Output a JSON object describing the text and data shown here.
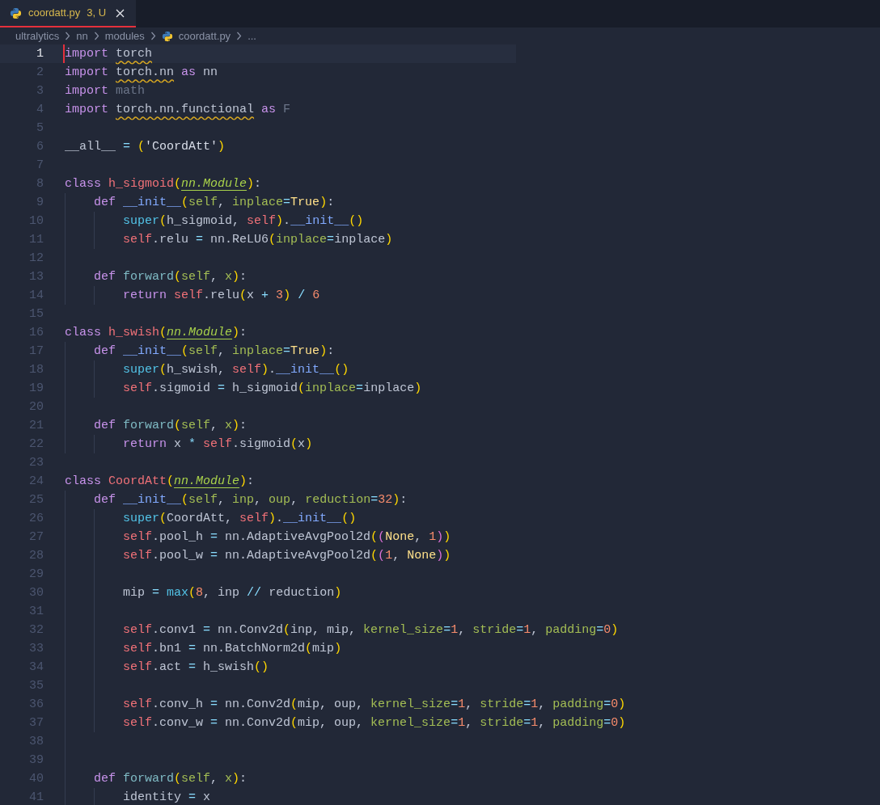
{
  "tab": {
    "filename": "coordatt.py",
    "badge": "3, U",
    "selected": true
  },
  "breadcrumb": [
    {
      "kind": "folder",
      "text": "ultralytics"
    },
    {
      "kind": "folder",
      "text": "nn"
    },
    {
      "kind": "folder",
      "text": "modules"
    },
    {
      "kind": "file",
      "text": "coordatt.py"
    },
    {
      "kind": "more",
      "text": "..."
    }
  ],
  "lines": [
    {
      "number": "1",
      "current": true,
      "tokens": [
        {
          "kind": "kw",
          "text": "import "
        },
        {
          "kind": "warn",
          "text": "torch"
        }
      ]
    },
    {
      "number": "2",
      "current": false,
      "tokens": [
        {
          "kind": "kw",
          "text": "import "
        },
        {
          "kind": "warn",
          "text": "torch.nn"
        },
        {
          "kind": "kw",
          "text": " as"
        },
        {
          "kind": "pl",
          "text": " nn"
        }
      ]
    },
    {
      "number": "3",
      "current": false,
      "tokens": [
        {
          "kind": "kw",
          "text": "import "
        },
        {
          "kind": "dim",
          "text": "math"
        }
      ]
    },
    {
      "number": "4",
      "current": false,
      "tokens": [
        {
          "kind": "kw",
          "text": "import "
        },
        {
          "kind": "warn",
          "text": "torch.nn.functional"
        },
        {
          "kind": "kw",
          "text": " as "
        },
        {
          "kind": "dim",
          "text": "F"
        }
      ]
    },
    {
      "number": "5",
      "current": false
    },
    {
      "number": "6",
      "current": false,
      "tokens": [
        {
          "kind": "pl",
          "text": "__all__ "
        },
        {
          "kind": "op",
          "text": "= "
        },
        {
          "kind": "p1",
          "text": "("
        },
        {
          "kind": "str",
          "text": "'CoordAtt'"
        },
        {
          "kind": "p1",
          "text": ")"
        }
      ]
    },
    {
      "number": "7",
      "current": false
    },
    {
      "number": "8",
      "current": false,
      "tokens": [
        {
          "kind": "kw",
          "text": "class "
        },
        {
          "kind": "cls",
          "text": "h_sigmoid"
        },
        {
          "kind": "p1",
          "text": "("
        },
        {
          "kind": "base",
          "text": "nn.Module"
        },
        {
          "kind": "p1",
          "text": ")"
        },
        {
          "kind": "pl",
          "text": ":"
        }
      ]
    },
    {
      "number": "9",
      "current": false,
      "tokens": [
        {
          "kind": "kw",
          "text": "    def "
        },
        {
          "kind": "fn",
          "text": "__init__"
        },
        {
          "kind": "p1",
          "text": "("
        },
        {
          "kind": "prm",
          "text": "self"
        },
        {
          "kind": "pl",
          "text": ", "
        },
        {
          "kind": "prm",
          "text": "inplace"
        },
        {
          "kind": "op",
          "text": "="
        },
        {
          "kind": "con",
          "text": "True"
        },
        {
          "kind": "p1",
          "text": ")"
        },
        {
          "kind": "pl",
          "text": ":"
        }
      ]
    },
    {
      "number": "10",
      "current": false,
      "tokens": [
        {
          "kind": "bi",
          "text": "        super"
        },
        {
          "kind": "p1",
          "text": "("
        },
        {
          "kind": "pl",
          "text": "h_sigmoid, "
        },
        {
          "kind": "slf",
          "text": "self"
        },
        {
          "kind": "p1",
          "text": ")"
        },
        {
          "kind": "pl",
          "text": "."
        },
        {
          "kind": "fn",
          "text": "__init__"
        },
        {
          "kind": "p1",
          "text": "()"
        }
      ]
    },
    {
      "number": "11",
      "current": false,
      "tokens": [
        {
          "kind": "slf",
          "text": "        self"
        },
        {
          "kind": "pl",
          "text": ".relu "
        },
        {
          "kind": "op",
          "text": "="
        },
        {
          "kind": "pl",
          "text": " nn.ReLU6"
        },
        {
          "kind": "p1",
          "text": "("
        },
        {
          "kind": "prm",
          "text": "inplace"
        },
        {
          "kind": "op",
          "text": "="
        },
        {
          "kind": "pl",
          "text": "inplace"
        },
        {
          "kind": "p1",
          "text": ")"
        }
      ]
    },
    {
      "number": "12",
      "current": false
    },
    {
      "number": "13",
      "current": false,
      "tokens": [
        {
          "kind": "kw",
          "text": "    def "
        },
        {
          "kind": "mth",
          "text": "forward"
        },
        {
          "kind": "p1",
          "text": "("
        },
        {
          "kind": "prm",
          "text": "self"
        },
        {
          "kind": "pl",
          "text": ", "
        },
        {
          "kind": "prm",
          "text": "x"
        },
        {
          "kind": "p1",
          "text": ")"
        },
        {
          "kind": "pl",
          "text": ":"
        }
      ]
    },
    {
      "number": "14",
      "current": false,
      "tokens": [
        {
          "kind": "kw",
          "text": "        return "
        },
        {
          "kind": "slf",
          "text": "self"
        },
        {
          "kind": "pl",
          "text": ".relu"
        },
        {
          "kind": "p1",
          "text": "("
        },
        {
          "kind": "pl",
          "text": "x "
        },
        {
          "kind": "op",
          "text": "+ "
        },
        {
          "kind": "num",
          "text": "3"
        },
        {
          "kind": "p1",
          "text": ") "
        },
        {
          "kind": "op",
          "text": "/ "
        },
        {
          "kind": "num",
          "text": "6"
        }
      ]
    },
    {
      "number": "15",
      "current": false
    },
    {
      "number": "16",
      "current": false,
      "tokens": [
        {
          "kind": "kw",
          "text": "class "
        },
        {
          "kind": "cls",
          "text": "h_swish"
        },
        {
          "kind": "p1",
          "text": "("
        },
        {
          "kind": "base",
          "text": "nn.Module"
        },
        {
          "kind": "p1",
          "text": ")"
        },
        {
          "kind": "pl",
          "text": ":"
        }
      ]
    },
    {
      "number": "17",
      "current": false,
      "tokens": [
        {
          "kind": "kw",
          "text": "    def "
        },
        {
          "kind": "fn",
          "text": "__init__"
        },
        {
          "kind": "p1",
          "text": "("
        },
        {
          "kind": "prm",
          "text": "self"
        },
        {
          "kind": "pl",
          "text": ", "
        },
        {
          "kind": "prm",
          "text": "inplace"
        },
        {
          "kind": "op",
          "text": "="
        },
        {
          "kind": "con",
          "text": "True"
        },
        {
          "kind": "p1",
          "text": ")"
        },
        {
          "kind": "pl",
          "text": ":"
        }
      ]
    },
    {
      "number": "18",
      "current": false,
      "tokens": [
        {
          "kind": "bi",
          "text": "        super"
        },
        {
          "kind": "p1",
          "text": "("
        },
        {
          "kind": "pl",
          "text": "h_swish, "
        },
        {
          "kind": "slf",
          "text": "self"
        },
        {
          "kind": "p1",
          "text": ")"
        },
        {
          "kind": "pl",
          "text": "."
        },
        {
          "kind": "fn",
          "text": "__init__"
        },
        {
          "kind": "p1",
          "text": "()"
        }
      ]
    },
    {
      "number": "19",
      "current": false,
      "tokens": [
        {
          "kind": "slf",
          "text": "        self"
        },
        {
          "kind": "pl",
          "text": ".sigmoid "
        },
        {
          "kind": "op",
          "text": "="
        },
        {
          "kind": "pl",
          "text": " h_sigmoid"
        },
        {
          "kind": "p1",
          "text": "("
        },
        {
          "kind": "prm",
          "text": "inplace"
        },
        {
          "kind": "op",
          "text": "="
        },
        {
          "kind": "pl",
          "text": "inplace"
        },
        {
          "kind": "p1",
          "text": ")"
        }
      ]
    },
    {
      "number": "20",
      "current": false
    },
    {
      "number": "21",
      "current": false,
      "tokens": [
        {
          "kind": "kw",
          "text": "    def "
        },
        {
          "kind": "mth",
          "text": "forward"
        },
        {
          "kind": "p1",
          "text": "("
        },
        {
          "kind": "prm",
          "text": "self"
        },
        {
          "kind": "pl",
          "text": ", "
        },
        {
          "kind": "prm",
          "text": "x"
        },
        {
          "kind": "p1",
          "text": ")"
        },
        {
          "kind": "pl",
          "text": ":"
        }
      ]
    },
    {
      "number": "22",
      "current": false,
      "tokens": [
        {
          "kind": "kw",
          "text": "        return"
        },
        {
          "kind": "pl",
          "text": " x "
        },
        {
          "kind": "op",
          "text": "* "
        },
        {
          "kind": "slf",
          "text": "self"
        },
        {
          "kind": "pl",
          "text": ".sigmoid"
        },
        {
          "kind": "p1",
          "text": "("
        },
        {
          "kind": "pl",
          "text": "x"
        },
        {
          "kind": "p1",
          "text": ")"
        }
      ]
    },
    {
      "number": "23",
      "current": false
    },
    {
      "number": "24",
      "current": false,
      "tokens": [
        {
          "kind": "kw",
          "text": "class "
        },
        {
          "kind": "cls",
          "text": "CoordAtt"
        },
        {
          "kind": "p1",
          "text": "("
        },
        {
          "kind": "base",
          "text": "nn.Module"
        },
        {
          "kind": "p1",
          "text": ")"
        },
        {
          "kind": "pl",
          "text": ":"
        }
      ]
    },
    {
      "number": "25",
      "current": false,
      "tokens": [
        {
          "kind": "kw",
          "text": "    def "
        },
        {
          "kind": "fn",
          "text": "__init__"
        },
        {
          "kind": "p1",
          "text": "("
        },
        {
          "kind": "prm",
          "text": "self"
        },
        {
          "kind": "pl",
          "text": ", "
        },
        {
          "kind": "prm",
          "text": "inp"
        },
        {
          "kind": "pl",
          "text": ", "
        },
        {
          "kind": "prm",
          "text": "oup"
        },
        {
          "kind": "pl",
          "text": ", "
        },
        {
          "kind": "prm",
          "text": "reduction"
        },
        {
          "kind": "op",
          "text": "="
        },
        {
          "kind": "num",
          "text": "32"
        },
        {
          "kind": "p1",
          "text": ")"
        },
        {
          "kind": "pl",
          "text": ":"
        }
      ]
    },
    {
      "number": "26",
      "current": false,
      "tokens": [
        {
          "kind": "bi",
          "text": "        super"
        },
        {
          "kind": "p1",
          "text": "("
        },
        {
          "kind": "pl",
          "text": "CoordAtt, "
        },
        {
          "kind": "slf",
          "text": "self"
        },
        {
          "kind": "p1",
          "text": ")"
        },
        {
          "kind": "pl",
          "text": "."
        },
        {
          "kind": "fn",
          "text": "__init__"
        },
        {
          "kind": "p1",
          "text": "()"
        }
      ]
    },
    {
      "number": "27",
      "current": false,
      "tokens": [
        {
          "kind": "slf",
          "text": "        self"
        },
        {
          "kind": "pl",
          "text": ".pool_h "
        },
        {
          "kind": "op",
          "text": "="
        },
        {
          "kind": "pl",
          "text": " nn.AdaptiveAvgPool2d"
        },
        {
          "kind": "p1",
          "text": "("
        },
        {
          "kind": "p2",
          "text": "("
        },
        {
          "kind": "con",
          "text": "None"
        },
        {
          "kind": "pl",
          "text": ", "
        },
        {
          "kind": "num",
          "text": "1"
        },
        {
          "kind": "p2",
          "text": ")"
        },
        {
          "kind": "p1",
          "text": ")"
        }
      ]
    },
    {
      "number": "28",
      "current": false,
      "tokens": [
        {
          "kind": "slf",
          "text": "        self"
        },
        {
          "kind": "pl",
          "text": ".pool_w "
        },
        {
          "kind": "op",
          "text": "="
        },
        {
          "kind": "pl",
          "text": " nn.AdaptiveAvgPool2d"
        },
        {
          "kind": "p1",
          "text": "("
        },
        {
          "kind": "p2",
          "text": "("
        },
        {
          "kind": "num",
          "text": "1"
        },
        {
          "kind": "pl",
          "text": ", "
        },
        {
          "kind": "con",
          "text": "None"
        },
        {
          "kind": "p2",
          "text": ")"
        },
        {
          "kind": "p1",
          "text": ")"
        }
      ]
    },
    {
      "number": "29",
      "current": false
    },
    {
      "number": "30",
      "current": false,
      "tokens": [
        {
          "kind": "pl",
          "text": "        mip "
        },
        {
          "kind": "op",
          "text": "= "
        },
        {
          "kind": "bi",
          "text": "max"
        },
        {
          "kind": "p1",
          "text": "("
        },
        {
          "kind": "num",
          "text": "8"
        },
        {
          "kind": "pl",
          "text": ", inp "
        },
        {
          "kind": "op",
          "text": "//"
        },
        {
          "kind": "pl",
          "text": " reduction"
        },
        {
          "kind": "p1",
          "text": ")"
        }
      ]
    },
    {
      "number": "31",
      "current": false
    },
    {
      "number": "32",
      "current": false,
      "tokens": [
        {
          "kind": "slf",
          "text": "        self"
        },
        {
          "kind": "pl",
          "text": ".conv1 "
        },
        {
          "kind": "op",
          "text": "="
        },
        {
          "kind": "pl",
          "text": " nn.Conv2d"
        },
        {
          "kind": "p1",
          "text": "("
        },
        {
          "kind": "pl",
          "text": "inp, mip, "
        },
        {
          "kind": "prm",
          "text": "kernel_size"
        },
        {
          "kind": "op",
          "text": "="
        },
        {
          "kind": "num",
          "text": "1"
        },
        {
          "kind": "pl",
          "text": ", "
        },
        {
          "kind": "prm",
          "text": "stride"
        },
        {
          "kind": "op",
          "text": "="
        },
        {
          "kind": "num",
          "text": "1"
        },
        {
          "kind": "pl",
          "text": ", "
        },
        {
          "kind": "prm",
          "text": "padding"
        },
        {
          "kind": "op",
          "text": "="
        },
        {
          "kind": "num",
          "text": "0"
        },
        {
          "kind": "p1",
          "text": ")"
        }
      ]
    },
    {
      "number": "33",
      "current": false,
      "tokens": [
        {
          "kind": "slf",
          "text": "        self"
        },
        {
          "kind": "pl",
          "text": ".bn1 "
        },
        {
          "kind": "op",
          "text": "="
        },
        {
          "kind": "pl",
          "text": " nn.BatchNorm2d"
        },
        {
          "kind": "p1",
          "text": "("
        },
        {
          "kind": "pl",
          "text": "mip"
        },
        {
          "kind": "p1",
          "text": ")"
        }
      ]
    },
    {
      "number": "34",
      "current": false,
      "tokens": [
        {
          "kind": "slf",
          "text": "        self"
        },
        {
          "kind": "pl",
          "text": ".act "
        },
        {
          "kind": "op",
          "text": "="
        },
        {
          "kind": "pl",
          "text": " h_swish"
        },
        {
          "kind": "p1",
          "text": "()"
        }
      ]
    },
    {
      "number": "35",
      "current": false
    },
    {
      "number": "36",
      "current": false,
      "tokens": [
        {
          "kind": "slf",
          "text": "        self"
        },
        {
          "kind": "pl",
          "text": ".conv_h "
        },
        {
          "kind": "op",
          "text": "="
        },
        {
          "kind": "pl",
          "text": " nn.Conv2d"
        },
        {
          "kind": "p1",
          "text": "("
        },
        {
          "kind": "pl",
          "text": "mip, oup, "
        },
        {
          "kind": "prm",
          "text": "kernel_size"
        },
        {
          "kind": "op",
          "text": "="
        },
        {
          "kind": "num",
          "text": "1"
        },
        {
          "kind": "pl",
          "text": ", "
        },
        {
          "kind": "prm",
          "text": "stride"
        },
        {
          "kind": "op",
          "text": "="
        },
        {
          "kind": "num",
          "text": "1"
        },
        {
          "kind": "pl",
          "text": ", "
        },
        {
          "kind": "prm",
          "text": "padding"
        },
        {
          "kind": "op",
          "text": "="
        },
        {
          "kind": "num",
          "text": "0"
        },
        {
          "kind": "p1",
          "text": ")"
        }
      ]
    },
    {
      "number": "37",
      "current": false,
      "tokens": [
        {
          "kind": "slf",
          "text": "        self"
        },
        {
          "kind": "pl",
          "text": ".conv_w "
        },
        {
          "kind": "op",
          "text": "="
        },
        {
          "kind": "pl",
          "text": " nn.Conv2d"
        },
        {
          "kind": "p1",
          "text": "("
        },
        {
          "kind": "pl",
          "text": "mip, oup, "
        },
        {
          "kind": "prm",
          "text": "kernel_size"
        },
        {
          "kind": "op",
          "text": "="
        },
        {
          "kind": "num",
          "text": "1"
        },
        {
          "kind": "pl",
          "text": ", "
        },
        {
          "kind": "prm",
          "text": "stride"
        },
        {
          "kind": "op",
          "text": "="
        },
        {
          "kind": "num",
          "text": "1"
        },
        {
          "kind": "pl",
          "text": ", "
        },
        {
          "kind": "prm",
          "text": "padding"
        },
        {
          "kind": "op",
          "text": "="
        },
        {
          "kind": "num",
          "text": "0"
        },
        {
          "kind": "p1",
          "text": ")"
        }
      ]
    },
    {
      "number": "38",
      "current": false
    },
    {
      "number": "39",
      "current": false
    },
    {
      "number": "40",
      "current": false,
      "tokens": [
        {
          "kind": "kw",
          "text": "    def "
        },
        {
          "kind": "mth",
          "text": "forward"
        },
        {
          "kind": "p1",
          "text": "("
        },
        {
          "kind": "prm",
          "text": "self"
        },
        {
          "kind": "pl",
          "text": ", "
        },
        {
          "kind": "prm",
          "text": "x"
        },
        {
          "kind": "p1",
          "text": ")"
        },
        {
          "kind": "pl",
          "text": ":"
        }
      ]
    },
    {
      "number": "41",
      "current": false,
      "tokens": [
        {
          "kind": "pl",
          "text": "        identity "
        },
        {
          "kind": "op",
          "text": "="
        },
        {
          "kind": "pl",
          "text": " x"
        }
      ]
    }
  ]
}
